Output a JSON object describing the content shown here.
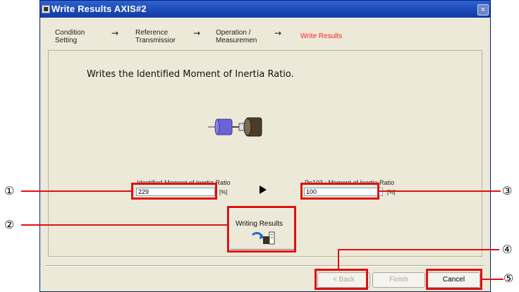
{
  "window": {
    "title": "Write Results AXIS#2",
    "app_icon_glyph": "■",
    "close_glyph": "×"
  },
  "steps": [
    {
      "label": "Condition\nSetting"
    },
    {
      "label": "Reference\nTransmissior"
    },
    {
      "label": "Operation /\nMeasuremen"
    },
    {
      "label": "Write Results",
      "active": true
    }
  ],
  "step_arrow": "→",
  "instruction": "Writes the Identified Moment of Inertia Ratio.",
  "identified": {
    "label": "Identified Moment of Inertia Ratio",
    "value": "229",
    "unit": "[%]"
  },
  "pn103": {
    "label": "Pn103 : Moment of Inertia Ratio",
    "value": "100",
    "unit": "[%]"
  },
  "write_button": {
    "label": "Writing Results"
  },
  "buttons": {
    "back": "< Back",
    "finish": "Finish",
    "cancel": "Cancel"
  },
  "callouts": [
    "①",
    "②",
    "③",
    "④",
    "⑤"
  ],
  "colors": {
    "title_bar": "#1c49b4",
    "active_step": "#ff2222",
    "callout_red": "#e01010",
    "window_face": "#ece9d8"
  }
}
